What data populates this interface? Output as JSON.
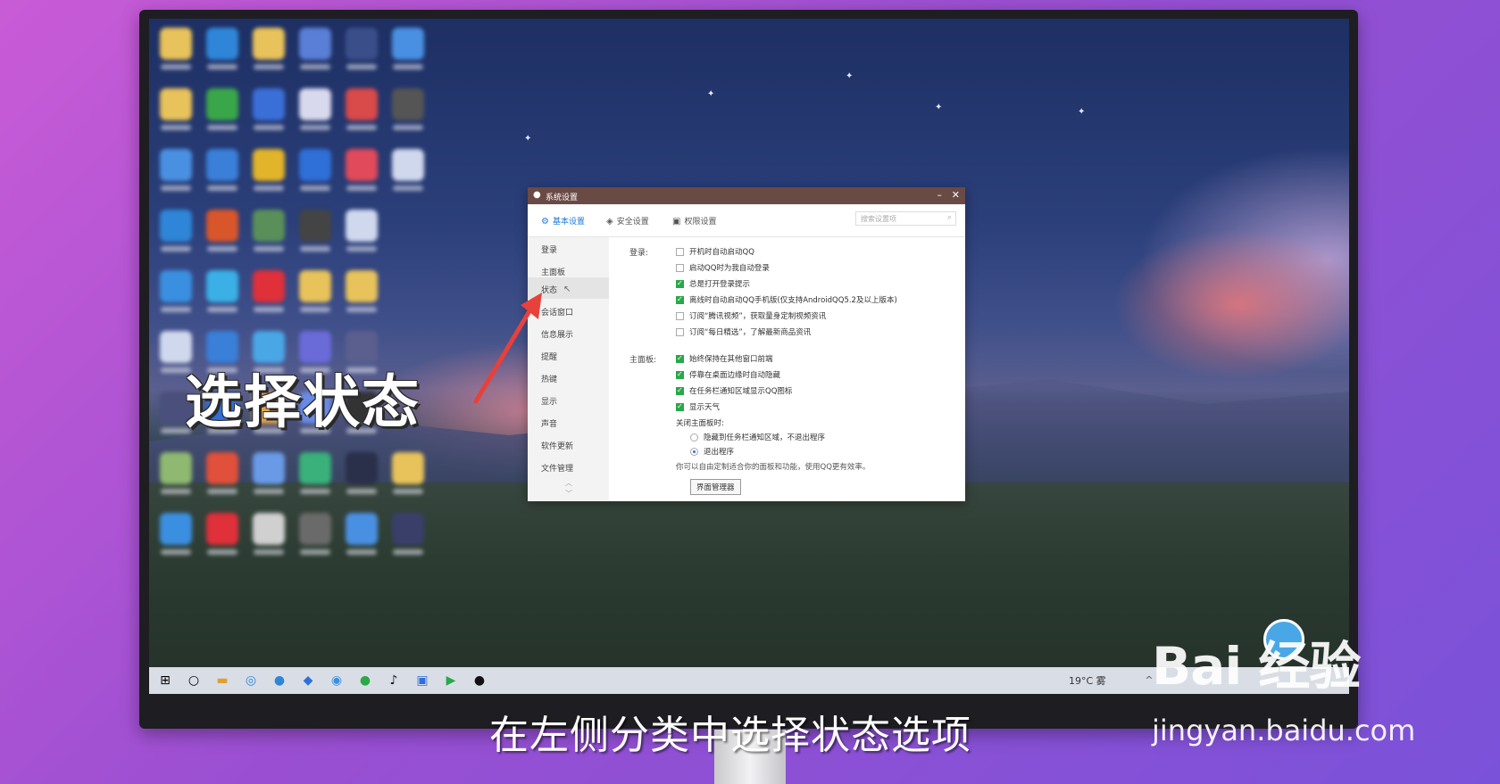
{
  "overlay": {
    "title": "选择状态",
    "subtitle": "在左侧分类中选择状态选项"
  },
  "watermark": {
    "logo_text": "Bai 经验",
    "url": "jingyan.baidu.com"
  },
  "taskbar": {
    "weather": "19°C 雾",
    "icons": [
      "windows-start-icon",
      "search-circle-icon",
      "file-explorer-icon",
      "browser-icon",
      "edge-icon",
      "mail-icon",
      "app-icon",
      "wechat-icon",
      "tiktok-icon",
      "screenshot-icon",
      "video-player-icon",
      "qq-penguin-icon"
    ]
  },
  "dialog": {
    "title": "系统设置",
    "minimize": "–",
    "close": "✕",
    "tabs": [
      {
        "label": "基本设置",
        "active": true
      },
      {
        "label": "安全设置",
        "active": false
      },
      {
        "label": "权限设置",
        "active": false
      }
    ],
    "search_placeholder": "搜索设置项",
    "sidebar": [
      {
        "label": "登录"
      },
      {
        "label": "主面板"
      },
      {
        "label": "状态",
        "selected": true
      },
      {
        "label": "会话窗口"
      },
      {
        "label": "信息展示"
      },
      {
        "label": "提醒"
      },
      {
        "label": "热键"
      },
      {
        "label": "显示"
      },
      {
        "label": "声音"
      },
      {
        "label": "软件更新"
      },
      {
        "label": "文件管理"
      }
    ],
    "login_section": {
      "label": "登录:",
      "options": [
        {
          "label": "开机时自动启动QQ",
          "checked": false
        },
        {
          "label": "启动QQ时为我自动登录",
          "checked": false
        },
        {
          "label": "总是打开登录提示",
          "checked": true
        },
        {
          "label": "离线时自动启动QQ手机版(仅支持AndroidQQ5.2及以上版本)",
          "checked": true
        },
        {
          "label": "订阅“腾讯视频”，获取量身定制视频资讯",
          "checked": false
        },
        {
          "label": "订阅“每日精选”，了解最新商品资讯",
          "checked": false
        }
      ]
    },
    "panel_section": {
      "label": "主面板:",
      "options": [
        {
          "label": "始终保持在其他窗口前端",
          "checked": true
        },
        {
          "label": "停靠在桌面边缘时自动隐藏",
          "checked": true
        },
        {
          "label": "在任务栏通知区域显示QQ图标",
          "checked": true
        },
        {
          "label": "显示天气",
          "checked": true
        }
      ],
      "close_label": "关闭主面板时:",
      "radios": [
        {
          "label": "隐藏到任务栏通知区域，不退出程序",
          "checked": false
        },
        {
          "label": "退出程序",
          "checked": true
        }
      ],
      "hint": "你可以自由定制适合你的面板和功能，使用QQ更有效率。",
      "manager_button": "界面管理器"
    }
  }
}
